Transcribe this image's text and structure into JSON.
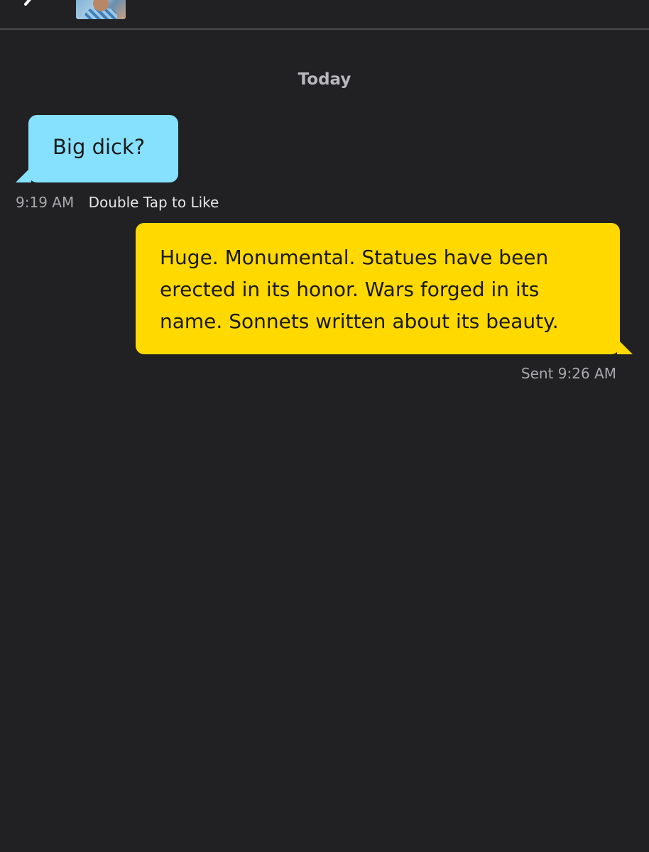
{
  "header": {
    "back_icon": "chevron-left-icon",
    "avatar_icon": "profile-avatar"
  },
  "conversation": {
    "date_separator": "Today",
    "messages": [
      {
        "direction": "incoming",
        "text": "Big dick?",
        "time": "9:19 AM",
        "action": "Double Tap to Like",
        "bubble_color": "#86e1ff"
      },
      {
        "direction": "outgoing",
        "text": "Huge. Monumental. Statues have been erected in its honor. Wars forged in its name. Sonnets written about its beauty.",
        "status": "Sent 9:26 AM",
        "bubble_color": "#ffd900"
      }
    ]
  },
  "colors": {
    "background": "#212123",
    "incoming_bubble": "#86e1ff",
    "outgoing_bubble": "#ffd900",
    "meta_text": "#a8a8ac"
  }
}
